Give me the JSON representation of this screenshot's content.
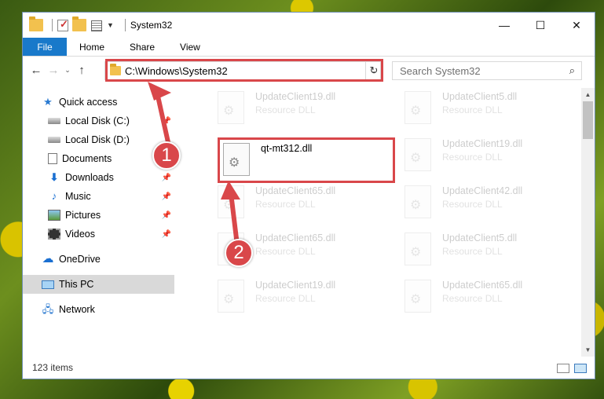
{
  "window": {
    "title": "System32",
    "controls": {
      "minimize": "—",
      "maximize": "☐",
      "close": "✕"
    }
  },
  "ribbon": {
    "tabs": [
      {
        "label": "File",
        "active": true
      },
      {
        "label": "Home"
      },
      {
        "label": "Share"
      },
      {
        "label": "View"
      }
    ]
  },
  "nav": {
    "back": "←",
    "forward": "→",
    "recent": "⌄",
    "up": "↑",
    "address": "C:\\Windows\\System32",
    "refresh": "↻",
    "search_placeholder": "Search System32",
    "search_icon": "⌕"
  },
  "sidebar": {
    "items": [
      {
        "label": "Quick access",
        "icon": "star-icon"
      },
      {
        "label": "Local Disk (C:)",
        "icon": "disk-icon"
      },
      {
        "label": "Local Disk (D:)",
        "icon": "disk-icon"
      },
      {
        "label": "Documents",
        "icon": "documents-icon"
      },
      {
        "label": "Downloads",
        "icon": "download-icon"
      },
      {
        "label": "Music",
        "icon": "music-icon"
      },
      {
        "label": "Pictures",
        "icon": "pictures-icon"
      },
      {
        "label": "Videos",
        "icon": "videos-icon"
      },
      {
        "label": "OneDrive",
        "icon": "cloud-icon"
      },
      {
        "label": "This PC",
        "icon": "computer-icon"
      },
      {
        "label": "Network",
        "icon": "network-icon"
      }
    ],
    "pin_glyph": "📌"
  },
  "files": [
    {
      "name": "UpdateClient19.dll",
      "type": "Resource DLL"
    },
    {
      "name": "UpdateClient5.dll",
      "type": "Resource DLL"
    },
    {
      "name": "qt-mt312.dll",
      "type": ""
    },
    {
      "name": "UpdateClient19.dll",
      "type": "Resource DLL"
    },
    {
      "name": "UpdateClient65.dll",
      "type": "Resource DLL"
    },
    {
      "name": "UpdateClient42.dll",
      "type": "Resource DLL"
    },
    {
      "name": "UpdateClient65.dll",
      "type": "Resource DLL"
    },
    {
      "name": "UpdateClient5.dll",
      "type": "Resource DLL"
    },
    {
      "name": "UpdateClient19.dll",
      "type": "Resource DLL"
    },
    {
      "name": "UpdateClient65.dll",
      "type": "Resource DLL"
    }
  ],
  "status": {
    "item_count": "123 items"
  },
  "callouts": [
    "1",
    "2"
  ],
  "colors": {
    "highlight": "#d9474a",
    "file_tab": "#1979ca"
  }
}
